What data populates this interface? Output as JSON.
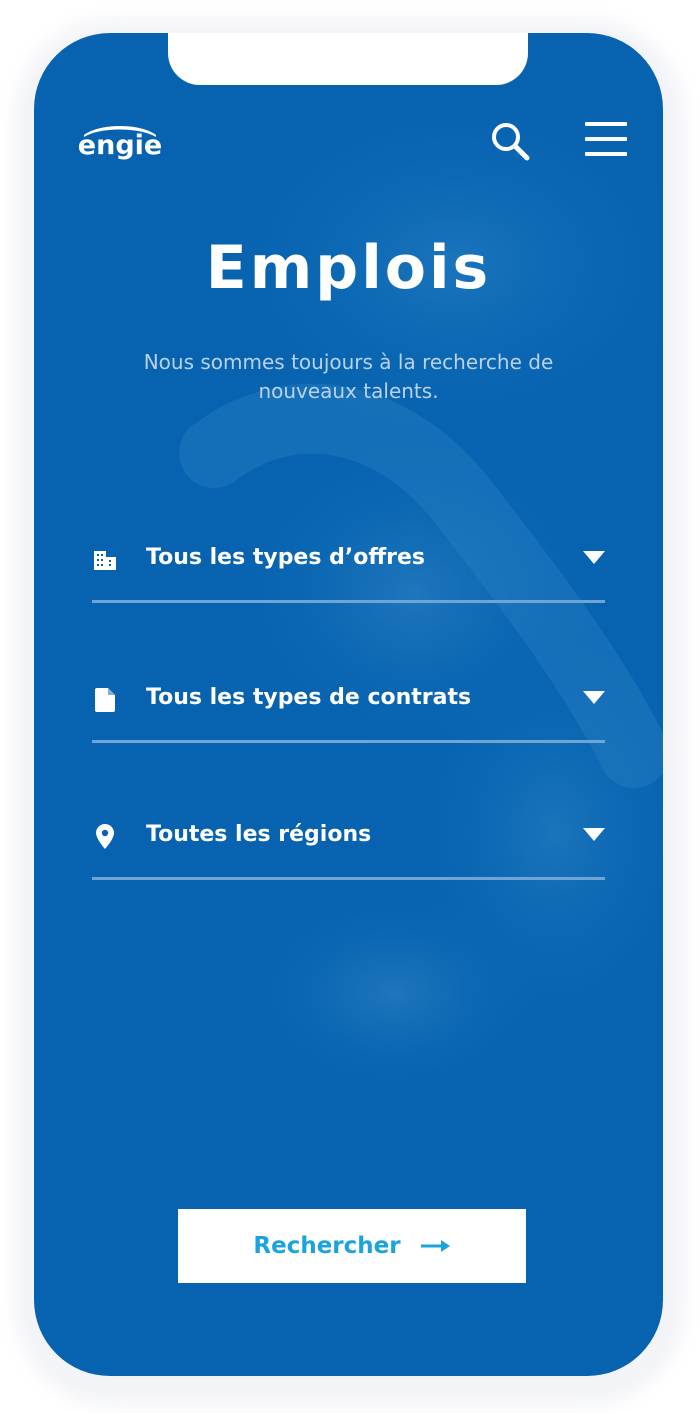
{
  "brand": {
    "logo_text": "engie",
    "primary_color": "#0763b0",
    "accent_color": "#1ba3db"
  },
  "header": {
    "search_icon": "search-icon",
    "menu_icon": "hamburger-menu-icon"
  },
  "hero": {
    "title": "Emplois",
    "subtitle": "Nous sommes toujours à la recherche de nouveaux talents."
  },
  "filters": [
    {
      "icon": "building-icon",
      "label": "Tous les types d’offres"
    },
    {
      "icon": "document-icon",
      "label": "Tous les types de contrats"
    },
    {
      "icon": "location-pin-icon",
      "label": "Toutes les régions"
    }
  ],
  "actions": {
    "search_label": "Rechercher",
    "search_icon": "arrow-right-icon"
  }
}
